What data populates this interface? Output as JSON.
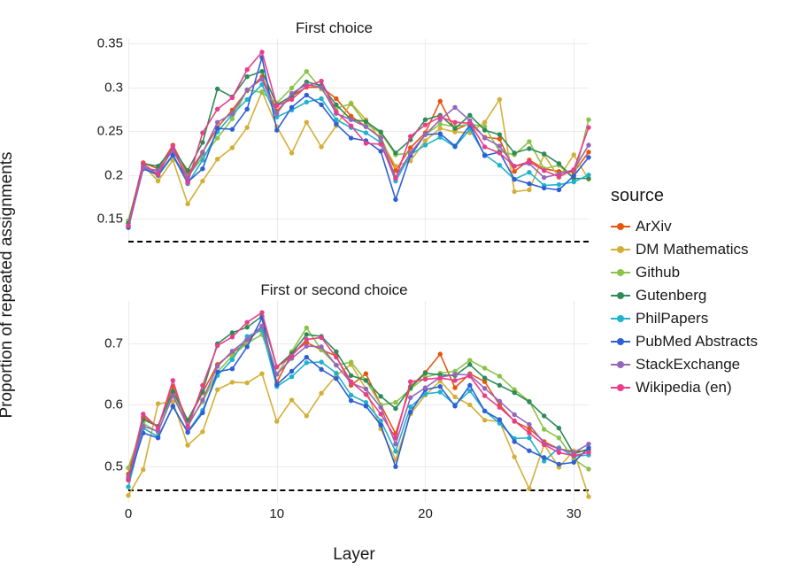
{
  "y_axis_label": "Proportion of repeated assignments",
  "x_axis_label": "Layer",
  "legend": {
    "title": "source",
    "items": [
      {
        "key": "ArXiv",
        "label": "ArXiv",
        "color": "#E6550D"
      },
      {
        "key": "DM_Mathematics",
        "label": "DM Mathematics",
        "color": "#D4AF37"
      },
      {
        "key": "Github",
        "label": "Github",
        "color": "#8BC34A"
      },
      {
        "key": "Gutenberg",
        "label": "Gutenberg",
        "color": "#2E8B57"
      },
      {
        "key": "PhilPapers",
        "label": "PhilPapers",
        "color": "#20B2CC"
      },
      {
        "key": "PubMed_Abstracts",
        "label": "PubMed Abstracts",
        "color": "#2E5FD4"
      },
      {
        "key": "StackExchange",
        "label": "StackExchange",
        "color": "#9467BD"
      },
      {
        "key": "Wikipedia_en",
        "label": "Wikipedia (en)",
        "color": "#E83E8C"
      }
    ]
  },
  "panels": [
    {
      "key": "top",
      "title": "First choice"
    },
    {
      "key": "bottom",
      "title": "First or second choice"
    }
  ],
  "chart_data": [
    {
      "panel": "top",
      "type": "line",
      "title": "First choice",
      "xlabel": "Layer",
      "ylabel": "Proportion of repeated assignments",
      "x": [
        0,
        1,
        2,
        3,
        4,
        5,
        6,
        7,
        8,
        9,
        10,
        11,
        12,
        13,
        14,
        15,
        16,
        17,
        18,
        19,
        20,
        21,
        22,
        23,
        24,
        25,
        26,
        27,
        28,
        29,
        30,
        31
      ],
      "x_ticks": [
        0,
        10,
        20,
        30
      ],
      "y_ticks": [
        0.15,
        0.2,
        0.25,
        0.3,
        0.35
      ],
      "ylim": [
        0.125,
        0.355
      ],
      "baseline": 0.125,
      "series": [
        {
          "name": "ArXiv",
          "color": "#E6550D",
          "values": [
            0.145,
            0.214,
            0.207,
            0.234,
            0.201,
            0.226,
            0.254,
            0.274,
            0.296,
            0.312,
            0.273,
            0.29,
            0.3,
            0.3,
            0.287,
            0.267,
            0.255,
            0.243,
            0.205,
            0.231,
            0.248,
            0.284,
            0.251,
            0.259,
            0.243,
            0.241,
            0.204,
            0.217,
            0.207,
            0.204,
            0.203,
            0.226
          ]
        },
        {
          "name": "DM Mathematics",
          "color": "#D4AF37",
          "values": [
            0.148,
            0.211,
            0.193,
            0.217,
            0.167,
            0.193,
            0.218,
            0.231,
            0.254,
            0.295,
            0.255,
            0.225,
            0.26,
            0.232,
            0.256,
            0.282,
            0.263,
            0.24,
            0.21,
            0.216,
            0.239,
            0.253,
            0.249,
            0.248,
            0.26,
            0.286,
            0.181,
            0.183,
            0.223,
            0.197,
            0.223,
            0.195
          ]
        },
        {
          "name": "Github",
          "color": "#8BC34A",
          "values": [
            0.148,
            0.21,
            0.202,
            0.229,
            0.198,
            0.22,
            0.242,
            0.264,
            0.297,
            0.294,
            0.282,
            0.299,
            0.318,
            0.298,
            0.276,
            0.281,
            0.258,
            0.248,
            0.223,
            0.225,
            0.246,
            0.258,
            0.255,
            0.258,
            0.255,
            0.227,
            0.223,
            0.238,
            0.207,
            0.211,
            0.196,
            0.263
          ]
        },
        {
          "name": "Gutenberg",
          "color": "#2E8B57",
          "values": [
            0.145,
            0.213,
            0.21,
            0.23,
            0.205,
            0.237,
            0.298,
            0.289,
            0.312,
            0.318,
            0.28,
            0.29,
            0.306,
            0.302,
            0.28,
            0.263,
            0.261,
            0.249,
            0.225,
            0.24,
            0.263,
            0.268,
            0.253,
            0.268,
            0.251,
            0.246,
            0.225,
            0.23,
            0.224,
            0.213,
            0.196,
            0.196
          ]
        },
        {
          "name": "PhilPapers",
          "color": "#20B2CC",
          "values": [
            0.14,
            0.21,
            0.199,
            0.222,
            0.19,
            0.217,
            0.249,
            0.269,
            0.286,
            0.303,
            0.266,
            0.274,
            0.283,
            0.287,
            0.263,
            0.254,
            0.248,
            0.237,
            0.193,
            0.223,
            0.234,
            0.243,
            0.232,
            0.252,
            0.223,
            0.211,
            0.195,
            0.203,
            0.188,
            0.189,
            0.192,
            0.2
          ]
        },
        {
          "name": "PubMed Abstracts",
          "color": "#2E5FD4",
          "values": [
            0.14,
            0.207,
            0.2,
            0.223,
            0.192,
            0.207,
            0.253,
            0.252,
            0.275,
            0.334,
            0.251,
            0.277,
            0.291,
            0.28,
            0.258,
            0.242,
            0.239,
            0.227,
            0.172,
            0.222,
            0.246,
            0.247,
            0.233,
            0.257,
            0.222,
            0.226,
            0.195,
            0.19,
            0.185,
            0.183,
            0.199,
            0.22
          ]
        },
        {
          "name": "StackExchange",
          "color": "#9467BD",
          "values": [
            0.142,
            0.208,
            0.205,
            0.228,
            0.197,
            0.225,
            0.26,
            0.27,
            0.297,
            0.309,
            0.27,
            0.293,
            0.303,
            0.3,
            0.27,
            0.263,
            0.255,
            0.242,
            0.197,
            0.225,
            0.246,
            0.263,
            0.277,
            0.262,
            0.242,
            0.233,
            0.21,
            0.213,
            0.197,
            0.201,
            0.206,
            0.234
          ]
        },
        {
          "name": "Wikipedia (en)",
          "color": "#E83E8C",
          "values": [
            0.142,
            0.213,
            0.2,
            0.233,
            0.191,
            0.248,
            0.275,
            0.288,
            0.32,
            0.34,
            0.279,
            0.286,
            0.301,
            0.307,
            0.272,
            0.256,
            0.236,
            0.235,
            0.196,
            0.244,
            0.257,
            0.266,
            0.26,
            0.259,
            0.232,
            0.225,
            0.21,
            0.215,
            0.205,
            0.198,
            0.206,
            0.254
          ]
        }
      ]
    },
    {
      "panel": "bottom",
      "type": "line",
      "title": "First or second choice",
      "xlabel": "Layer",
      "ylabel": "Proportion of repeated assignments",
      "x": [
        0,
        1,
        2,
        3,
        4,
        5,
        6,
        7,
        8,
        9,
        10,
        11,
        12,
        13,
        14,
        15,
        16,
        17,
        18,
        19,
        20,
        21,
        22,
        23,
        24,
        25,
        26,
        27,
        28,
        29,
        30,
        31
      ],
      "x_ticks": [
        0,
        10,
        20,
        30
      ],
      "y_ticks": [
        0.5,
        0.6,
        0.7
      ],
      "ylim": [
        0.44,
        0.77
      ],
      "baseline": 0.462,
      "series": [
        {
          "name": "ArXiv",
          "color": "#E6550D",
          "values": [
            0.487,
            0.58,
            0.565,
            0.63,
            0.573,
            0.62,
            0.666,
            0.685,
            0.703,
            0.728,
            0.637,
            0.684,
            0.702,
            0.69,
            0.68,
            0.632,
            0.651,
            0.6,
            0.553,
            0.63,
            0.653,
            0.683,
            0.628,
            0.651,
            0.638,
            0.6,
            0.573,
            0.561,
            0.54,
            0.528,
            0.524,
            0.525
          ]
        },
        {
          "name": "DM Mathematics",
          "color": "#D4AF37",
          "values": [
            0.452,
            0.494,
            0.602,
            0.605,
            0.534,
            0.556,
            0.625,
            0.637,
            0.636,
            0.651,
            0.573,
            0.608,
            0.582,
            0.619,
            0.648,
            0.666,
            0.626,
            0.561,
            0.51,
            0.585,
            0.616,
            0.639,
            0.613,
            0.6,
            0.575,
            0.573,
            0.515,
            0.463,
            0.535,
            0.498,
            0.525,
            0.45
          ]
        },
        {
          "name": "Github",
          "color": "#8BC34A",
          "values": [
            0.497,
            0.57,
            0.555,
            0.617,
            0.569,
            0.605,
            0.654,
            0.68,
            0.701,
            0.715,
            0.65,
            0.687,
            0.726,
            0.69,
            0.665,
            0.67,
            0.64,
            0.6,
            0.604,
            0.626,
            0.645,
            0.652,
            0.655,
            0.673,
            0.66,
            0.647,
            0.625,
            0.606,
            0.56,
            0.546,
            0.511,
            0.495
          ]
        },
        {
          "name": "Gutenberg",
          "color": "#2E8B57",
          "values": [
            0.479,
            0.576,
            0.565,
            0.622,
            0.575,
            0.622,
            0.7,
            0.718,
            0.727,
            0.745,
            0.662,
            0.684,
            0.715,
            0.712,
            0.687,
            0.648,
            0.64,
            0.614,
            0.594,
            0.628,
            0.652,
            0.649,
            0.648,
            0.666,
            0.644,
            0.632,
            0.62,
            0.605,
            0.582,
            0.562,
            0.52,
            0.528
          ]
        },
        {
          "name": "PhilPapers",
          "color": "#20B2CC",
          "values": [
            0.466,
            0.562,
            0.548,
            0.597,
            0.556,
            0.591,
            0.648,
            0.674,
            0.712,
            0.722,
            0.63,
            0.646,
            0.669,
            0.67,
            0.652,
            0.616,
            0.604,
            0.574,
            0.524,
            0.597,
            0.618,
            0.621,
            0.6,
            0.623,
            0.59,
            0.57,
            0.545,
            0.546,
            0.508,
            0.53,
            0.516,
            0.518
          ]
        },
        {
          "name": "PubMed Abstracts",
          "color": "#2E5FD4",
          "values": [
            0.477,
            0.554,
            0.546,
            0.598,
            0.555,
            0.587,
            0.654,
            0.659,
            0.695,
            0.742,
            0.633,
            0.655,
            0.678,
            0.658,
            0.643,
            0.607,
            0.598,
            0.567,
            0.499,
            0.588,
            0.625,
            0.63,
            0.598,
            0.632,
            0.59,
            0.576,
            0.54,
            0.525,
            0.514,
            0.503,
            0.506,
            0.53
          ]
        },
        {
          "name": "StackExchange",
          "color": "#9467BD",
          "values": [
            0.482,
            0.565,
            0.557,
            0.615,
            0.565,
            0.608,
            0.663,
            0.688,
            0.707,
            0.729,
            0.65,
            0.676,
            0.696,
            0.695,
            0.665,
            0.636,
            0.626,
            0.596,
            0.536,
            0.612,
            0.628,
            0.645,
            0.65,
            0.649,
            0.627,
            0.606,
            0.584,
            0.568,
            0.537,
            0.528,
            0.522,
            0.536
          ]
        },
        {
          "name": "Wikipedia (en)",
          "color": "#E83E8C",
          "values": [
            0.477,
            0.585,
            0.562,
            0.64,
            0.563,
            0.632,
            0.697,
            0.711,
            0.735,
            0.751,
            0.662,
            0.68,
            0.707,
            0.71,
            0.678,
            0.638,
            0.617,
            0.585,
            0.546,
            0.638,
            0.642,
            0.644,
            0.64,
            0.647,
            0.615,
            0.596,
            0.574,
            0.554,
            0.535,
            0.522,
            0.517,
            0.522
          ]
        }
      ]
    }
  ]
}
